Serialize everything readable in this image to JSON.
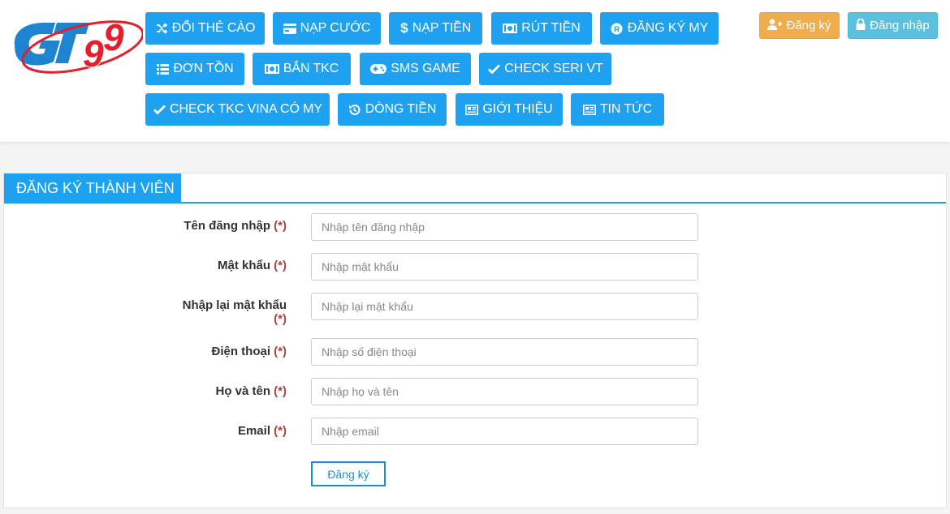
{
  "brand": {
    "logo_text": "GT99",
    "colors": {
      "primary_blue": "#1ea1f1",
      "logo_red": "#e41f2d",
      "warning": "#f0ad4e",
      "info": "#5bc0de"
    }
  },
  "nav": {
    "items": [
      {
        "label": "ĐỔI THẺ CÀO",
        "icon": "shuffle-icon"
      },
      {
        "label": "NẠP CƯỚC",
        "icon": "credit-card-icon"
      },
      {
        "label": "NẠP TIỀN",
        "icon": "dollar-icon"
      },
      {
        "label": "RÚT TIỀN",
        "icon": "money-bill-icon"
      },
      {
        "label": "ĐĂNG KÝ MY",
        "icon": "registered-icon"
      },
      {
        "label": "ĐƠN TỒN",
        "icon": "list-icon"
      },
      {
        "label": "BẮN TKC",
        "icon": "money-bill-icon"
      },
      {
        "label": "SMS GAME",
        "icon": "gamepad-icon"
      },
      {
        "label": "CHECK SERI VT",
        "icon": "check-icon"
      },
      {
        "label": "CHECK TKC VINA CÓ MY",
        "icon": "check-icon"
      },
      {
        "label": "DÒNG TIỀN",
        "icon": "history-icon"
      },
      {
        "label": "GIỚI THIỆU",
        "icon": "newspaper-icon"
      },
      {
        "label": "TIN TỨC",
        "icon": "newspaper-icon"
      }
    ]
  },
  "auth": {
    "register_label": "Đăng ký",
    "login_label": "Đăng nhập"
  },
  "form": {
    "title": "ĐĂNG KÝ THÀNH VIÊN",
    "required_mark": "(*)",
    "fields": [
      {
        "label": "Tên đăng nhập",
        "placeholder": "Nhập tên đăng nhập",
        "value": ""
      },
      {
        "label": "Mật khẩu",
        "placeholder": "Nhập mật khẩu",
        "value": ""
      },
      {
        "label": "Nhập lại mật khẩu",
        "placeholder": "Nhập lại mật khẩu",
        "value": ""
      },
      {
        "label": "Điện thoại",
        "placeholder": "Nhập số điện thoại",
        "value": ""
      },
      {
        "label": "Họ và tên",
        "placeholder": "Nhập họ và tên",
        "value": ""
      },
      {
        "label": "Email",
        "placeholder": "Nhập email",
        "value": ""
      }
    ],
    "submit_label": "Đăng ký"
  }
}
